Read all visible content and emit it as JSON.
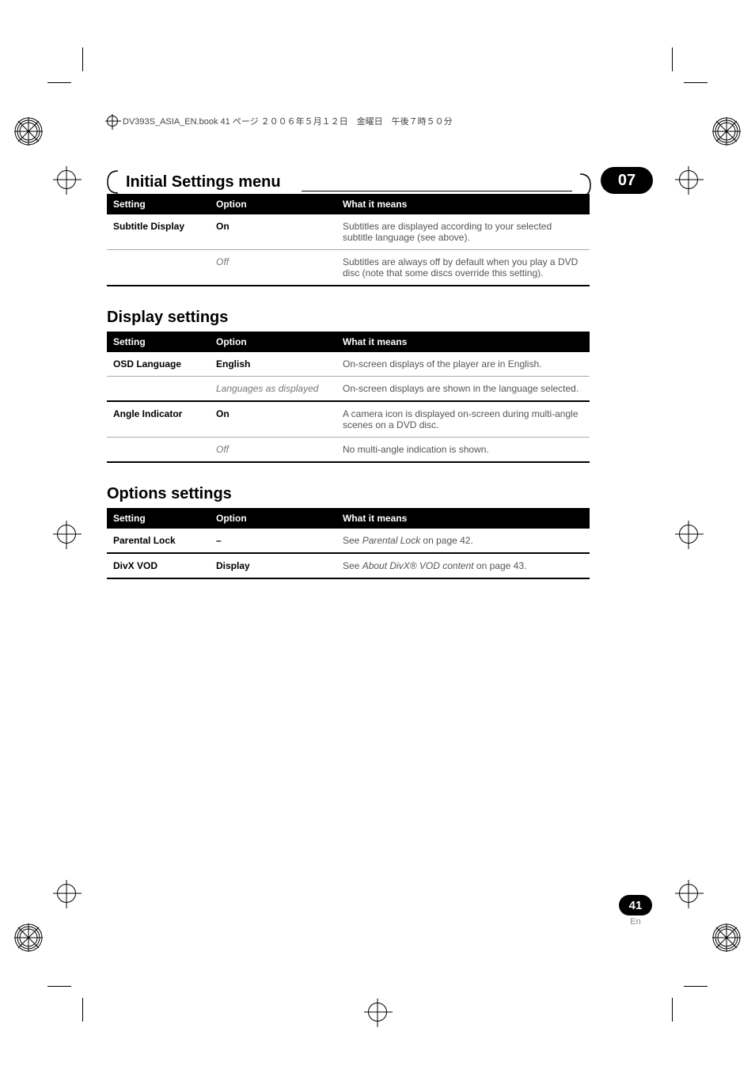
{
  "book_tag": "DV393S_ASIA_EN.book  41 ページ  ２００６年５月１２日　金曜日　午後７時５０分",
  "chapter_title": "Initial Settings menu",
  "chapter_number": "07",
  "tables": {
    "subtitle": {
      "headers": {
        "setting": "Setting",
        "option": "Option",
        "meaning": "What it means"
      },
      "rows": [
        {
          "setting": "Subtitle Display",
          "option": "On",
          "option_style": "bold",
          "meaning": "Subtitles are displayed according to your selected subtitle language (see above)."
        },
        {
          "setting": "",
          "option": "Off",
          "option_style": "italic",
          "meaning": "Subtitles are always off by default when you play a DVD disc (note that some discs override this setting)."
        }
      ]
    },
    "display": {
      "heading": "Display settings",
      "headers": {
        "setting": "Setting",
        "option": "Option",
        "meaning": "What it means"
      },
      "rows": [
        {
          "setting": "OSD Language",
          "option": "English",
          "option_style": "bold",
          "meaning": "On-screen displays of the player are in English."
        },
        {
          "setting": "",
          "option": "Languages as displayed",
          "option_style": "italic",
          "meaning": "On-screen displays are shown in the language selected."
        },
        {
          "setting": "Angle Indicator",
          "option": "On",
          "option_style": "bold",
          "meaning": "A camera icon is displayed on-screen during multi-angle scenes on a DVD disc."
        },
        {
          "setting": "",
          "option": "Off",
          "option_style": "italic",
          "meaning": "No multi-angle indication is shown."
        }
      ]
    },
    "options": {
      "heading": "Options settings",
      "headers": {
        "setting": "Setting",
        "option": "Option",
        "meaning": "What it means"
      },
      "rows": [
        {
          "setting": "Parental Lock",
          "option": "–",
          "option_style": "bold",
          "meaning_prefix": "See ",
          "meaning_italic": "Parental Lock",
          "meaning_suffix": " on page 42."
        },
        {
          "setting": "DivX VOD",
          "option": "Display",
          "option_style": "bold",
          "meaning_prefix": "See ",
          "meaning_italic": "About DivX® VOD content",
          "meaning_suffix": " on page 43."
        }
      ]
    }
  },
  "page_number": "41",
  "lang": "En"
}
